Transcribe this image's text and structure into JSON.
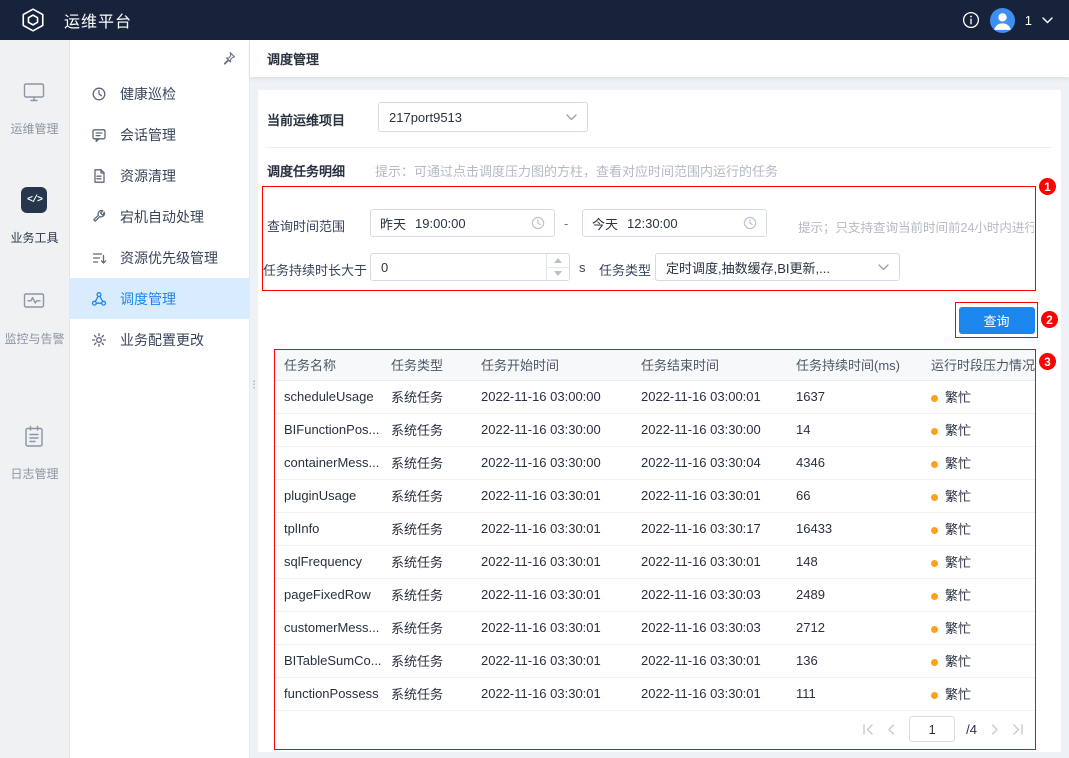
{
  "topbar": {
    "title": "运维平台",
    "user_badge": "1"
  },
  "nav_primary": {
    "items": [
      {
        "label": "运维管理"
      },
      {
        "label": "业务工具"
      },
      {
        "label": "监控与告警"
      },
      {
        "label": "日志管理"
      }
    ]
  },
  "nav_secondary": {
    "items": [
      {
        "label": "健康巡检"
      },
      {
        "label": "会话管理"
      },
      {
        "label": "资源清理"
      },
      {
        "label": "宕机自动处理"
      },
      {
        "label": "资源优先级管理"
      },
      {
        "label": "调度管理"
      },
      {
        "label": "业务配置更改"
      }
    ]
  },
  "breadcrumb": {
    "title": "调度管理"
  },
  "project": {
    "label": "当前运维项目",
    "value": "217port9513"
  },
  "detail": {
    "title": "调度任务明细",
    "hint": "提示：可通过点击调度压力图的方柱，查看对应时间范围内运行的任务"
  },
  "filters": {
    "time_range_label": "查询时间范围",
    "time_from_day": "昨天",
    "time_from_value": "19:00:00",
    "range_separator": "-",
    "time_to_day": "今天",
    "time_to_value": "12:30:00",
    "time_hint": "提示；只支持查询当前时间前24小时内进行",
    "duration_label": "任务持续时长大于",
    "duration_value": "0",
    "duration_unit": "s",
    "task_type_label": "任务类型",
    "task_type_value": "定时调度,抽数缓存,BI更新,...",
    "search_label": "查询"
  },
  "table": {
    "busy_color": "#ffa21a",
    "columns": [
      "任务名称",
      "任务类型",
      "任务开始时间",
      "任务结束时间",
      "任务持续时间(ms)",
      "运行时段压力情况"
    ],
    "rows": [
      {
        "name": "scheduleUsage",
        "type": "系统任务",
        "start": "2022-11-16 03:00:00",
        "end": "2022-11-16 03:00:01",
        "duration_ms": "1637",
        "pressure": "繁忙"
      },
      {
        "name": "BIFunctionPos...",
        "type": "系统任务",
        "start": "2022-11-16 03:30:00",
        "end": "2022-11-16 03:30:00",
        "duration_ms": "14",
        "pressure": "繁忙"
      },
      {
        "name": "containerMess...",
        "type": "系统任务",
        "start": "2022-11-16 03:30:00",
        "end": "2022-11-16 03:30:04",
        "duration_ms": "4346",
        "pressure": "繁忙"
      },
      {
        "name": "pluginUsage",
        "type": "系统任务",
        "start": "2022-11-16 03:30:01",
        "end": "2022-11-16 03:30:01",
        "duration_ms": "66",
        "pressure": "繁忙"
      },
      {
        "name": "tplInfo",
        "type": "系统任务",
        "start": "2022-11-16 03:30:01",
        "end": "2022-11-16 03:30:17",
        "duration_ms": "16433",
        "pressure": "繁忙"
      },
      {
        "name": "sqlFrequency",
        "type": "系统任务",
        "start": "2022-11-16 03:30:01",
        "end": "2022-11-16 03:30:01",
        "duration_ms": "148",
        "pressure": "繁忙"
      },
      {
        "name": "pageFixedRow",
        "type": "系统任务",
        "start": "2022-11-16 03:30:01",
        "end": "2022-11-16 03:30:03",
        "duration_ms": "2489",
        "pressure": "繁忙"
      },
      {
        "name": "customerMess...",
        "type": "系统任务",
        "start": "2022-11-16 03:30:01",
        "end": "2022-11-16 03:30:03",
        "duration_ms": "2712",
        "pressure": "繁忙"
      },
      {
        "name": "BITableSumCo...",
        "type": "系统任务",
        "start": "2022-11-16 03:30:01",
        "end": "2022-11-16 03:30:01",
        "duration_ms": "136",
        "pressure": "繁忙"
      },
      {
        "name": "functionPossess",
        "type": "系统任务",
        "start": "2022-11-16 03:30:01",
        "end": "2022-11-16 03:30:01",
        "duration_ms": "111",
        "pressure": "繁忙"
      }
    ]
  },
  "pagination": {
    "current": "1",
    "total_label": "/4"
  },
  "annotations": {
    "one": "1",
    "two": "2",
    "three": "3"
  },
  "theme": {
    "accent_blue": "#1b87ee",
    "annotation_red": "#fe0100",
    "topbar_bg": "#17233a",
    "active_item_bg": "#d9ecff"
  }
}
